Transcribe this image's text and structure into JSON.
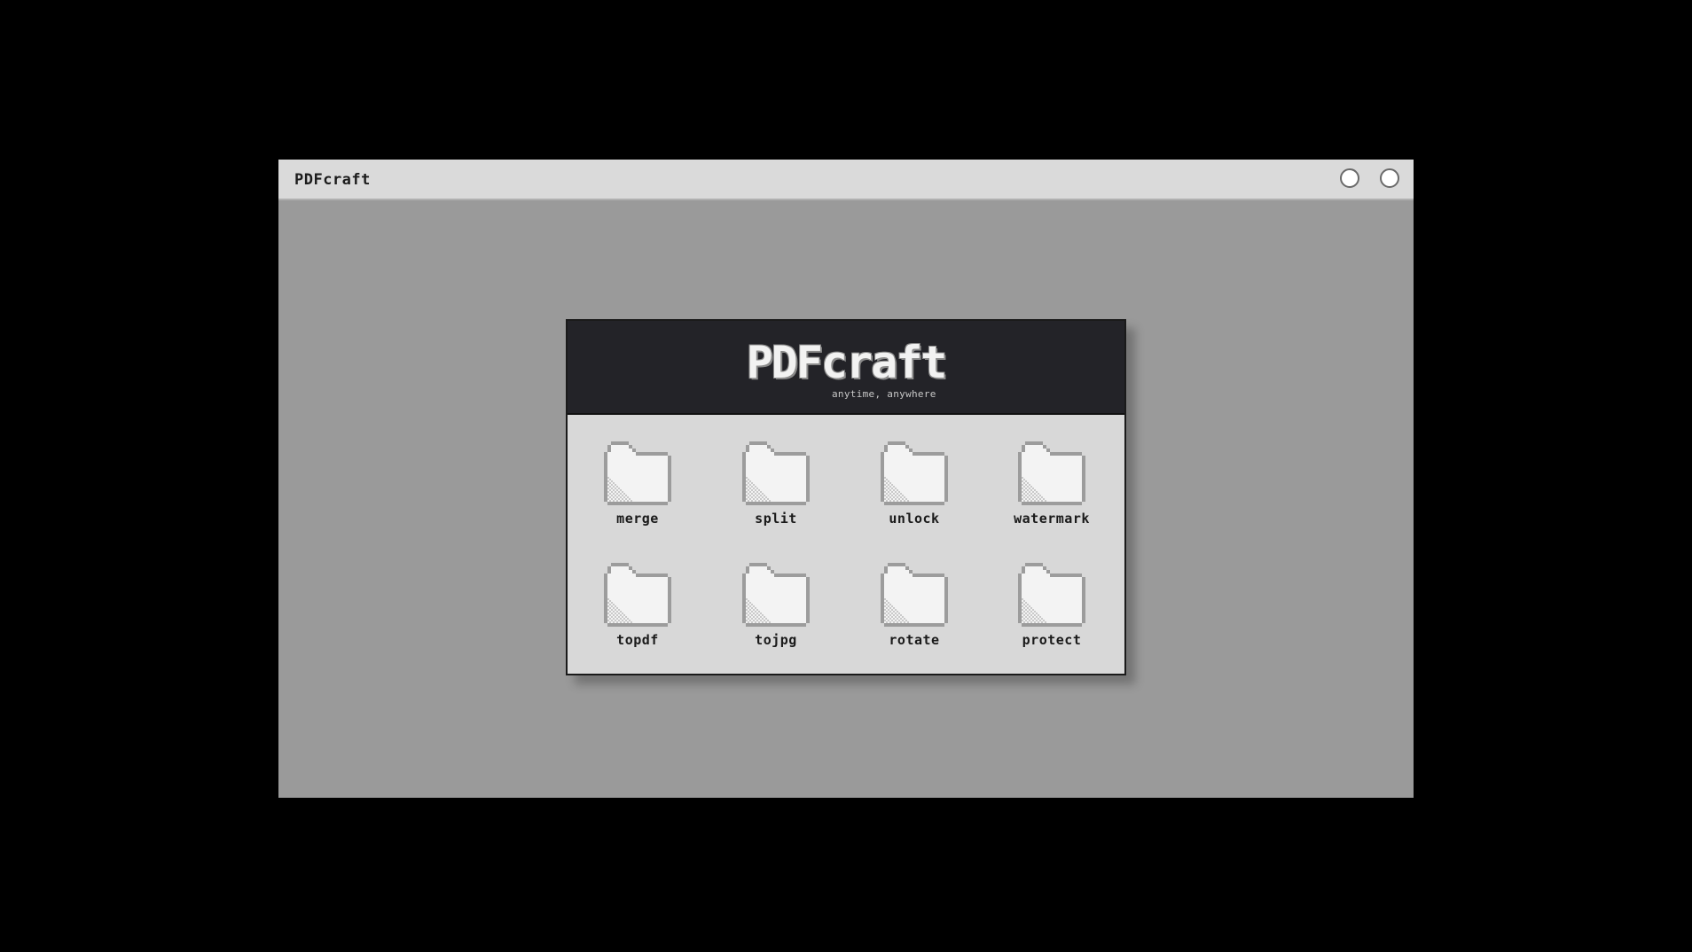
{
  "window": {
    "title": "PDFcraft"
  },
  "panel": {
    "logo": "PDFcraft",
    "tagline": "anytime, anywhere"
  },
  "tools": [
    {
      "label": "merge",
      "icon": "folder-icon"
    },
    {
      "label": "split",
      "icon": "folder-icon"
    },
    {
      "label": "unlock",
      "icon": "folder-icon"
    },
    {
      "label": "watermark",
      "icon": "folder-icon"
    },
    {
      "label": "topdf",
      "icon": "folder-icon"
    },
    {
      "label": "tojpg",
      "icon": "folder-icon"
    },
    {
      "label": "rotate",
      "icon": "folder-icon"
    },
    {
      "label": "protect",
      "icon": "folder-icon"
    }
  ],
  "colors": {
    "desktop": "#000000",
    "window_bg": "#9a9a9a",
    "titlebar": "#dadada",
    "panel_header": "#232328",
    "panel_body": "#d8d8d8"
  }
}
